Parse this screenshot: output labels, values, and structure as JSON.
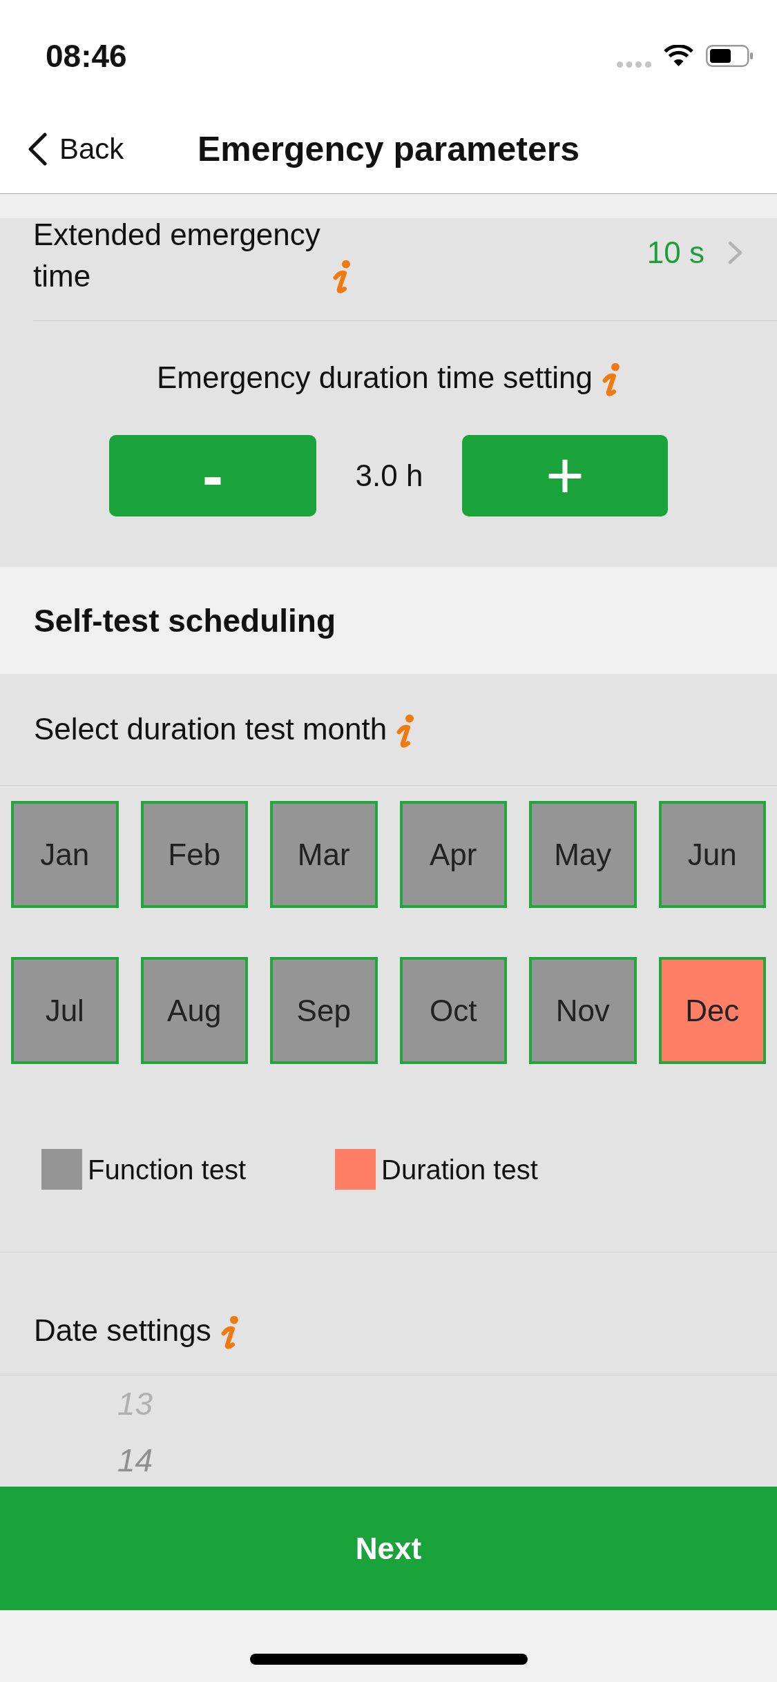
{
  "status_bar": {
    "time": "08:46"
  },
  "nav_bar": {
    "back_label": "Back",
    "title": "Emergency parameters"
  },
  "extended_emergency_time": {
    "label": "Extended emergency time",
    "value": "10 s"
  },
  "duration_setting": {
    "label": "Emergency duration time setting",
    "decrement": "-",
    "value": "3.0 h",
    "increment": "+"
  },
  "self_test_scheduling": {
    "title": "Self-test scheduling",
    "month_prompt": "Select duration test month",
    "months": [
      {
        "label": "Jan",
        "selected": false
      },
      {
        "label": "Feb",
        "selected": false
      },
      {
        "label": "Mar",
        "selected": false
      },
      {
        "label": "Apr",
        "selected": false
      },
      {
        "label": "May",
        "selected": false
      },
      {
        "label": "Jun",
        "selected": false
      },
      {
        "label": "Jul",
        "selected": false
      },
      {
        "label": "Aug",
        "selected": false
      },
      {
        "label": "Sep",
        "selected": false
      },
      {
        "label": "Oct",
        "selected": false
      },
      {
        "label": "Nov",
        "selected": false
      },
      {
        "label": "Dec",
        "selected": true
      }
    ],
    "legend": [
      {
        "label": "Function test",
        "color": "#959595"
      },
      {
        "label": "Duration test",
        "color": "#ff7f66"
      }
    ]
  },
  "date_settings": {
    "label": "Date settings",
    "picker": [
      {
        "text": "13",
        "faded": true
      },
      {
        "text": "14",
        "faded": false
      }
    ]
  },
  "next_button": {
    "label": "Next"
  }
}
